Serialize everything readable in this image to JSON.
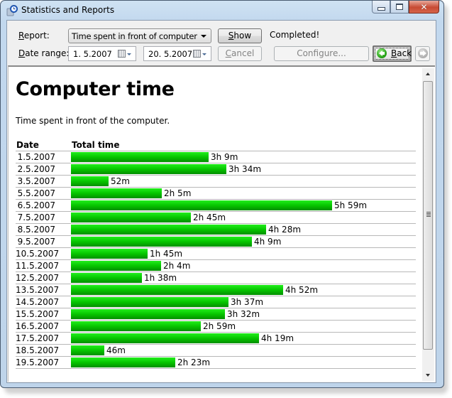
{
  "window": {
    "title": "Statistics and Reports",
    "buttons": {
      "minimize": "minimize",
      "maximize": "maximize",
      "close": "✕"
    }
  },
  "toolbar": {
    "report_label_key": "R",
    "report_label_rest": "eport:",
    "report_value": "Time spent in front of computer",
    "date_range_label_key": "D",
    "date_range_label_rest": "ate range:",
    "date_from": "1.  5.2007",
    "date_to": "20.  5.2007",
    "show_key": "S",
    "show_rest": "how",
    "cancel_key": "C",
    "cancel_rest": "ancel",
    "status": "Completed!",
    "configure_label": "Configure...",
    "back_key": "B",
    "back_rest": "ack"
  },
  "report": {
    "title": "Computer time",
    "description": "Time spent in front of the computer.",
    "columns": [
      "Date",
      "Total time"
    ],
    "bar_color": "#06c500"
  },
  "chart_data": {
    "type": "bar",
    "title": "Computer time",
    "xlabel": "Total time",
    "ylabel": "Date",
    "unit": "minutes",
    "categories": [
      "1.5.2007",
      "2.5.2007",
      "3.5.2007",
      "5.5.2007",
      "6.5.2007",
      "7.5.2007",
      "8.5.2007",
      "9.5.2007",
      "10.5.2007",
      "11.5.2007",
      "12.5.2007",
      "13.5.2007",
      "14.5.2007",
      "15.5.2007",
      "16.5.2007",
      "17.5.2007",
      "18.5.2007",
      "19.5.2007"
    ],
    "values": [
      189,
      214,
      52,
      125,
      359,
      165,
      268,
      249,
      105,
      124,
      98,
      292,
      217,
      212,
      179,
      259,
      46,
      143
    ],
    "labels": [
      "3h 9m",
      "3h 34m",
      "52m",
      "2h 5m",
      "5h 59m",
      "2h 45m",
      "4h 28m",
      "4h 9m",
      "1h 45m",
      "2h 4m",
      "1h 38m",
      "4h 52m",
      "3h 37m",
      "3h 32m",
      "2h 59m",
      "4h 19m",
      "46m",
      "2h 23m"
    ],
    "xlim": [
      0,
      359
    ]
  }
}
